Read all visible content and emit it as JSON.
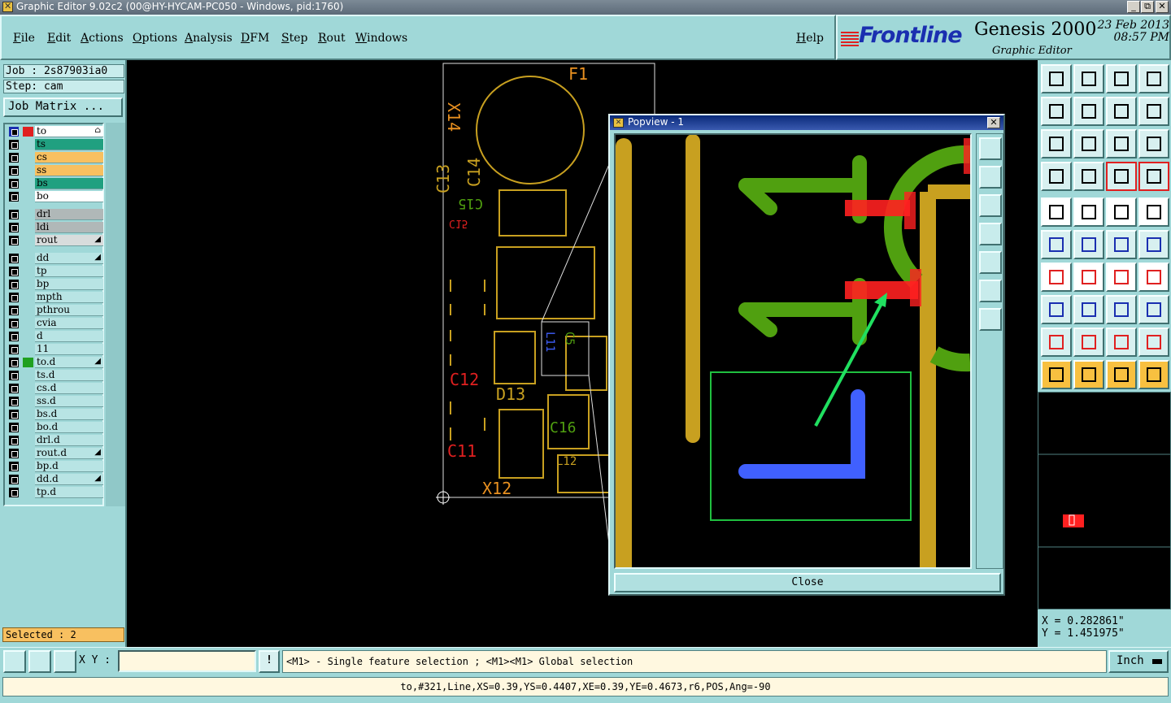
{
  "window": {
    "title": "Graphic Editor 9.02c2 (00@HY-HYCAM-PC050 - Windows, pid:1760)",
    "buttons": [
      "_",
      "⧉",
      "✕"
    ]
  },
  "menu": {
    "items": [
      "File",
      "Edit",
      "Actions",
      "Options",
      "Analysis",
      "DFM",
      "Step",
      "Rout",
      "Windows"
    ],
    "help": "Help"
  },
  "logo": {
    "brand": "Frontline",
    "product": "Genesis 2000",
    "subtitle": "Graphic Editor",
    "date": "23 Feb 2013",
    "time": "08:57 PM"
  },
  "job": {
    "job_label": "Job : 2s87903ia0",
    "step_label": "Step: cam",
    "matrix_button": "Job Matrix ..."
  },
  "layers": [
    {
      "name": "to",
      "color": "#ffffff",
      "active": true,
      "flag": "⌂"
    },
    {
      "name": "ts",
      "color": "#20a080"
    },
    {
      "name": "cs",
      "color": "#f8c060"
    },
    {
      "name": "ss",
      "color": "#f8c060"
    },
    {
      "name": "bs",
      "color": "#20a080"
    },
    {
      "name": "bo",
      "color": "#ffffff"
    },
    {
      "name": "drl",
      "color": "#b0b8b8"
    },
    {
      "name": "ldi",
      "color": "#b0b8b8"
    },
    {
      "name": "rout",
      "color": "#d8dcdc",
      "flag": "◢"
    },
    {
      "name": "dd",
      "color": "#b8e4e4",
      "flag": "◢"
    },
    {
      "name": "tp",
      "color": "#b8e4e4"
    },
    {
      "name": "bp",
      "color": "#b8e4e4"
    },
    {
      "name": "mpth",
      "color": "#b8e4e4"
    },
    {
      "name": "pthrou",
      "color": "#b8e4e4"
    },
    {
      "name": "cvia",
      "color": "#b8e4e4"
    },
    {
      "name": "d",
      "color": "#b8e4e4"
    },
    {
      "name": "11",
      "color": "#b8e4e4"
    },
    {
      "name": "to.d",
      "color": "#b8e4e4",
      "flag": "◢",
      "marked": true
    },
    {
      "name": "ts.d",
      "color": "#b8e4e4"
    },
    {
      "name": "cs.d",
      "color": "#b8e4e4"
    },
    {
      "name": "ss.d",
      "color": "#b8e4e4"
    },
    {
      "name": "bs.d",
      "color": "#b8e4e4"
    },
    {
      "name": "bo.d",
      "color": "#b8e4e4"
    },
    {
      "name": "drl.d",
      "color": "#b8e4e4"
    },
    {
      "name": "rout.d",
      "color": "#b8e4e4",
      "flag": "◢"
    },
    {
      "name": "bp.d",
      "color": "#b8e4e4"
    },
    {
      "name": "dd.d",
      "color": "#b8e4e4",
      "flag": "◢"
    },
    {
      "name": "tp.d",
      "color": "#b8e4e4"
    }
  ],
  "selected": "Selected : 2",
  "board_labels": {
    "f1": "F1",
    "x14": "X14",
    "c13": "C13",
    "c14": "C14",
    "c15": "C15",
    "c15_mirror": "C15",
    "c12": "C12",
    "d13": "D13",
    "c11": "C11",
    "x12": "X12",
    "l11": "L11",
    "c5": "C5",
    "c16": "C16",
    "l12": "L12"
  },
  "popview": {
    "title": "Popview - 1",
    "close_label": "Close"
  },
  "coords": {
    "x": "X = 0.282861\"",
    "y": "Y = 1.451975\""
  },
  "bottom": {
    "xy_label": "X Y :",
    "xy_value": "",
    "help_glyph": "!",
    "hint": "<M1> - Single feature selection ; <M1><M1> Global selection",
    "units": "Inch"
  },
  "status": "to,#321,Line,XS=0.39,YS=0.4407,XE=0.39,YE=0.4673,r6,POS,Ang=-90",
  "colors": {
    "panel": "#a0d8d8",
    "copper": "#c8a020",
    "silk_green": "#50a010",
    "highlight_red": "#ff2020",
    "drill_blue": "#4060ff",
    "arrow_green": "#20e060"
  }
}
